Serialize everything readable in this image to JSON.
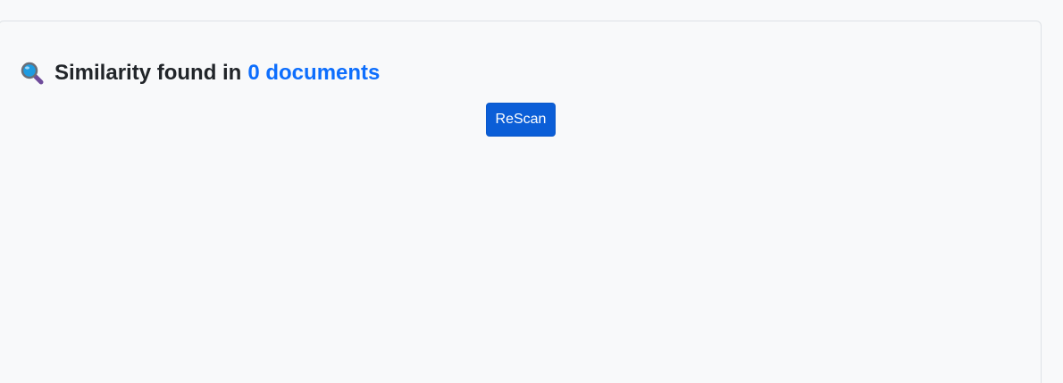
{
  "similarity": {
    "icon": "magnifying-glass-icon",
    "prefix": "Similarity found in",
    "count_link": "0 documents",
    "link_color": "#0d6efd"
  },
  "actions": {
    "rescan_label": "ReScan",
    "button_color": "#0b5ed7"
  }
}
